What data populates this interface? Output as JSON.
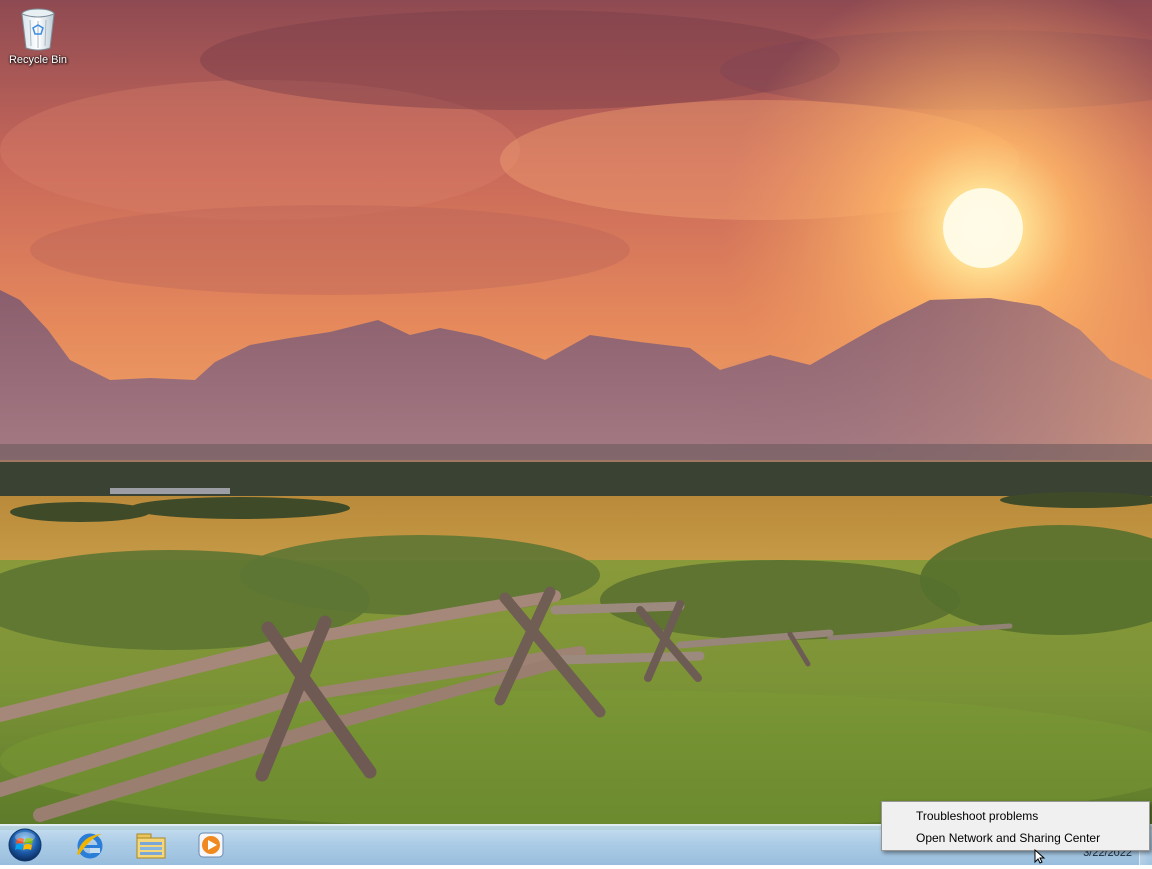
{
  "desktop": {
    "icons": [
      {
        "label": "Recycle Bin",
        "icon": "recycle-bin-icon"
      }
    ]
  },
  "taskbar": {
    "start_icon": "windows-start-orb-icon",
    "pinned": [
      {
        "name": "Internet Explorer",
        "icon": "internet-explorer-icon"
      },
      {
        "name": "Windows Explorer",
        "icon": "folder-library-icon"
      },
      {
        "name": "Windows Media Player",
        "icon": "media-player-icon"
      }
    ],
    "clock": {
      "date": "3/22/2022"
    },
    "accent": "#a7c9e6"
  },
  "context_menu": {
    "items": [
      {
        "label": "Troubleshoot problems"
      },
      {
        "label": "Open Network and Sharing Center"
      }
    ]
  }
}
